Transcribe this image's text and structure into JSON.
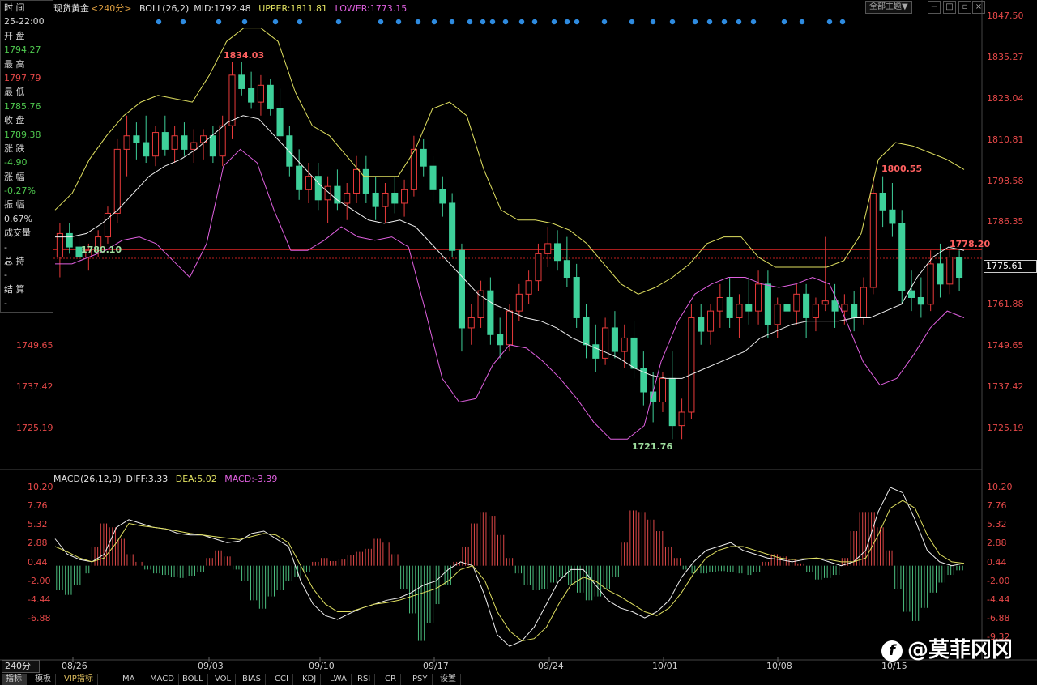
{
  "header": {
    "symbol": "现货黄金",
    "period": "<240分>",
    "boll_label": "BOLL(26,2)",
    "mid": "MID:1792.48",
    "upper": "UPPER:1811.81",
    "lower": "LOWER:1773.15",
    "theme_button": "全部主题▼",
    "colors": {
      "mid": "#f0f0f0",
      "upper": "#e0e060",
      "lower": "#e060e0"
    }
  },
  "info_panel": [
    {
      "label": "时 间",
      "value": "25-22:00",
      "tone": "white"
    },
    {
      "label": "开 盘",
      "value": "1794.27",
      "tone": "green"
    },
    {
      "label": "最 高",
      "value": "1797.79",
      "tone": "red"
    },
    {
      "label": "最 低",
      "value": "1785.76",
      "tone": "green"
    },
    {
      "label": "收 盘",
      "value": "1789.38",
      "tone": "green"
    },
    {
      "label": "涨 跌",
      "value": "-4.90",
      "tone": "green"
    },
    {
      "label": "涨 幅",
      "value": "-0.27%",
      "tone": "green"
    },
    {
      "label": "振 幅",
      "value": "0.67%",
      "tone": "white"
    },
    {
      "label": "成交量",
      "value": "-",
      "tone": "white"
    },
    {
      "label": "总 持",
      "value": "-",
      "tone": "white"
    },
    {
      "label": "结 算",
      "value": "-",
      "tone": "white"
    }
  ],
  "price_axis_right": [
    "1847.50",
    "1835.27",
    "1823.04",
    "1810.81",
    "1798.58",
    "1786.35",
    "1761.88",
    "1749.65",
    "1737.42",
    "1725.19"
  ],
  "price_axis_left": [
    "1749.65",
    "1737.42",
    "1725.19"
  ],
  "current_price_tag": "1775.61",
  "date_labels": [
    "08/26",
    "09/03",
    "09/10",
    "09/17",
    "09/24",
    "10/01",
    "10/08",
    "10/15"
  ],
  "annotations": [
    {
      "text": "1834.03",
      "color": "#ff6060"
    },
    {
      "text": "1780.10",
      "color": "#a0e0a0"
    },
    {
      "text": "1721.76",
      "color": "#a0e0a0"
    },
    {
      "text": "1800.55",
      "color": "#ff6060"
    },
    {
      "text": "1778.20",
      "color": "#ff6060"
    }
  ],
  "macd_header": {
    "label": "MACD(26,12,9)",
    "diff": "DIFF:3.33",
    "dea": "DEA:5.02",
    "macd": "MACD:-3.39"
  },
  "macd_axis": [
    "10.20",
    "7.76",
    "5.32",
    "2.88",
    "0.44",
    "-2.00",
    "-4.44",
    "-6.88",
    "-9.32"
  ],
  "period_button": "240分",
  "tabs": [
    "指标",
    "模板",
    "VIP指标",
    "MA",
    "MACD",
    "BOLL",
    "VOL",
    "BIAS",
    "CCI",
    "KDJ",
    "LWA",
    "RSI",
    "CR",
    "PSY",
    "设置"
  ],
  "watermark": "@莫菲冈冈",
  "chart_data": {
    "type": "candlestick",
    "title": "",
    "ylim": [
      1715,
      1850
    ],
    "reference_price": 1778.2,
    "ohlc": [
      [
        1776,
        1786,
        1770,
        1783
      ],
      [
        1783,
        1786,
        1777,
        1779
      ],
      [
        1779,
        1782,
        1774,
        1776
      ],
      [
        1776,
        1780,
        1772,
        1778
      ],
      [
        1778,
        1784,
        1776,
        1782
      ],
      [
        1782,
        1791,
        1780,
        1789
      ],
      [
        1789,
        1811,
        1786,
        1808
      ],
      [
        1808,
        1818,
        1800,
        1812
      ],
      [
        1812,
        1816,
        1805,
        1810
      ],
      [
        1810,
        1818,
        1804,
        1806
      ],
      [
        1806,
        1815,
        1803,
        1813
      ],
      [
        1813,
        1818,
        1806,
        1808
      ],
      [
        1808,
        1815,
        1804,
        1812
      ],
      [
        1812,
        1816,
        1806,
        1808
      ],
      [
        1808,
        1814,
        1804,
        1810
      ],
      [
        1810,
        1814,
        1805,
        1812
      ],
      [
        1812,
        1815,
        1804,
        1806
      ],
      [
        1806,
        1818,
        1803,
        1815
      ],
      [
        1815,
        1834,
        1811,
        1830
      ],
      [
        1830,
        1834,
        1824,
        1826
      ],
      [
        1826,
        1831,
        1820,
        1822
      ],
      [
        1822,
        1830,
        1818,
        1827
      ],
      [
        1827,
        1829,
        1818,
        1820
      ],
      [
        1820,
        1826,
        1810,
        1812
      ],
      [
        1812,
        1815,
        1800,
        1803
      ],
      [
        1803,
        1808,
        1793,
        1796
      ],
      [
        1796,
        1804,
        1792,
        1800
      ],
      [
        1800,
        1804,
        1790,
        1793
      ],
      [
        1793,
        1800,
        1786,
        1797
      ],
      [
        1797,
        1802,
        1790,
        1792
      ],
      [
        1792,
        1798,
        1787,
        1795
      ],
      [
        1795,
        1806,
        1792,
        1802
      ],
      [
        1802,
        1806,
        1792,
        1795
      ],
      [
        1795,
        1800,
        1787,
        1791
      ],
      [
        1791,
        1798,
        1786,
        1795
      ],
      [
        1795,
        1800,
        1789,
        1792
      ],
      [
        1792,
        1799,
        1788,
        1796
      ],
      [
        1796,
        1812,
        1794,
        1808
      ],
      [
        1808,
        1811,
        1800,
        1803
      ],
      [
        1803,
        1806,
        1792,
        1796
      ],
      [
        1796,
        1800,
        1788,
        1792
      ],
      [
        1792,
        1795,
        1776,
        1778
      ],
      [
        1778,
        1780,
        1748,
        1755
      ],
      [
        1755,
        1762,
        1750,
        1758
      ],
      [
        1758,
        1769,
        1755,
        1766
      ],
      [
        1766,
        1770,
        1750,
        1753
      ],
      [
        1753,
        1758,
        1746,
        1750
      ],
      [
        1750,
        1762,
        1748,
        1760
      ],
      [
        1760,
        1768,
        1757,
        1765
      ],
      [
        1765,
        1772,
        1762,
        1769
      ],
      [
        1769,
        1780,
        1766,
        1777
      ],
      [
        1777,
        1785,
        1773,
        1780
      ],
      [
        1780,
        1784,
        1772,
        1775
      ],
      [
        1775,
        1782,
        1767,
        1770
      ],
      [
        1770,
        1774,
        1755,
        1758
      ],
      [
        1758,
        1762,
        1746,
        1750
      ],
      [
        1750,
        1756,
        1742,
        1746
      ],
      [
        1746,
        1758,
        1744,
        1755
      ],
      [
        1755,
        1760,
        1746,
        1748
      ],
      [
        1748,
        1756,
        1743,
        1752
      ],
      [
        1752,
        1757,
        1740,
        1743
      ],
      [
        1743,
        1748,
        1732,
        1736
      ],
      [
        1736,
        1742,
        1727,
        1733
      ],
      [
        1733,
        1742,
        1730,
        1740
      ],
      [
        1740,
        1748,
        1722,
        1726
      ],
      [
        1726,
        1734,
        1722,
        1730
      ],
      [
        1730,
        1762,
        1728,
        1758
      ],
      [
        1758,
        1762,
        1750,
        1754
      ],
      [
        1754,
        1762,
        1750,
        1760
      ],
      [
        1760,
        1768,
        1755,
        1764
      ],
      [
        1764,
        1770,
        1755,
        1758
      ],
      [
        1758,
        1765,
        1752,
        1762
      ],
      [
        1762,
        1770,
        1756,
        1760
      ],
      [
        1760,
        1772,
        1756,
        1768
      ],
      [
        1768,
        1772,
        1752,
        1756
      ],
      [
        1756,
        1764,
        1752,
        1762
      ],
      [
        1762,
        1768,
        1755,
        1760
      ],
      [
        1760,
        1768,
        1756,
        1765
      ],
      [
        1765,
        1768,
        1752,
        1758
      ],
      [
        1758,
        1764,
        1754,
        1762
      ],
      [
        1762,
        1782,
        1760,
        1763
      ],
      [
        1763,
        1768,
        1755,
        1760
      ],
      [
        1760,
        1765,
        1756,
        1762
      ],
      [
        1762,
        1766,
        1754,
        1758
      ],
      [
        1758,
        1770,
        1756,
        1767
      ],
      [
        1767,
        1800,
        1765,
        1795
      ],
      [
        1795,
        1800,
        1785,
        1790
      ],
      [
        1790,
        1798,
        1782,
        1786
      ],
      [
        1786,
        1790,
        1762,
        1766
      ],
      [
        1766,
        1772,
        1760,
        1764
      ],
      [
        1764,
        1770,
        1758,
        1762
      ],
      [
        1762,
        1778,
        1760,
        1774
      ],
      [
        1774,
        1780,
        1764,
        1768
      ],
      [
        1768,
        1778,
        1765,
        1776
      ],
      [
        1776,
        1778,
        1766,
        1770
      ]
    ],
    "boll_mid": [
      1782,
      1782,
      1783,
      1786,
      1790,
      1795,
      1800,
      1803,
      1805,
      1808,
      1812,
      1816,
      1818,
      1817,
      1812,
      1807,
      1802,
      1797,
      1793,
      1790,
      1787,
      1786,
      1787,
      1785,
      1780,
      1775,
      1770,
      1765,
      1762,
      1760,
      1758,
      1757,
      1755,
      1752,
      1750,
      1748,
      1746,
      1743,
      1741,
      1740,
      1740,
      1742,
      1744,
      1746,
      1748,
      1752,
      1754,
      1756,
      1757,
      1757,
      1757,
      1758,
      1758,
      1760,
      1762,
      1770,
      1776,
      1779,
      1778
    ],
    "boll_upper": [
      1790,
      1795,
      1805,
      1812,
      1818,
      1822,
      1824,
      1823,
      1822,
      1830,
      1840,
      1844,
      1844,
      1840,
      1825,
      1815,
      1812,
      1806,
      1800,
      1800,
      1800,
      1808,
      1820,
      1822,
      1818,
      1802,
      1790,
      1787,
      1787,
      1786,
      1784,
      1780,
      1774,
      1768,
      1765,
      1767,
      1770,
      1774,
      1780,
      1782,
      1782,
      1776,
      1773,
      1773,
      1773,
      1773,
      1775,
      1783,
      1805,
      1810,
      1809,
      1807,
      1805,
      1802
    ],
    "boll_lower": [
      1774,
      1774,
      1776,
      1778,
      1781,
      1782,
      1780,
      1775,
      1770,
      1780,
      1803,
      1808,
      1804,
      1790,
      1778,
      1778,
      1781,
      1785,
      1782,
      1781,
      1782,
      1779,
      1760,
      1740,
      1733,
      1734,
      1744,
      1750,
      1749,
      1745,
      1740,
      1734,
      1727,
      1722,
      1722,
      1726,
      1745,
      1757,
      1765,
      1768,
      1770,
      1770,
      1768,
      1767,
      1768,
      1770,
      1768,
      1757,
      1745,
      1738,
      1740,
      1747,
      1755,
      1760,
      1758
    ],
    "macd_hist": [
      -3.2,
      -3.8,
      -2.5,
      -1,
      2.5,
      5.5,
      5,
      3.5,
      1.5,
      0.5,
      -0.5,
      -1,
      -1.2,
      -1.5,
      -1.6,
      -1.3,
      -0.8,
      1,
      2,
      1.2,
      -0.5,
      -2,
      -4.5,
      -5.6,
      -4,
      -3.2,
      -2,
      -1.5,
      -0.8,
      0.5,
      1,
      0.6,
      0.8,
      1.4,
      1.8,
      2.2,
      3.5,
      3,
      1.5,
      -3,
      -6.2,
      -9.8,
      -7.5,
      -5,
      -2.5,
      0.5,
      2.5,
      5.5,
      7,
      6.5,
      4,
      1,
      -1,
      -2.5,
      -3.2,
      -3,
      -2.2,
      -1.5,
      -2.5,
      -3.5,
      -4.5,
      -4,
      -3,
      -1.5,
      3,
      7.2,
      7,
      6,
      4.5,
      2.5,
      1,
      -0.5,
      -1,
      -1,
      -0.8,
      -0.7,
      -0.8,
      -1,
      -1.2,
      -0.8,
      0.5,
      1.5,
      1.2,
      0.8,
      0.3,
      -0.8,
      -1.8,
      -1.6,
      -1.2,
      1,
      4.5,
      7,
      7,
      5,
      2,
      -3,
      -6,
      -7.2,
      -5.5,
      -3.5,
      -2.2,
      -1.2,
      -0.6
    ],
    "diff": [
      3.5,
      1.5,
      0.8,
      0.5,
      1.5,
      5,
      6,
      5.5,
      5,
      4.8,
      4.2,
      4,
      4,
      3.5,
      3,
      3.2,
      4.2,
      4.5,
      3.5,
      2.5,
      -2,
      -5,
      -6.5,
      -7,
      -6.2,
      -5.5,
      -5,
      -4.5,
      -4.2,
      -3.5,
      -2.5,
      -2,
      -0.5,
      0.5,
      0,
      -4,
      -9,
      -10.5,
      -9.8,
      -8,
      -5,
      -2,
      -0.5,
      -0.5,
      -2.5,
      -4.5,
      -5.5,
      -6,
      -6.8,
      -6,
      -4.5,
      -1.5,
      0.5,
      2,
      2.5,
      3,
      2,
      1.5,
      1,
      0.8,
      0.5,
      0.8,
      1,
      0.5,
      0,
      0.5,
      2,
      7,
      10.2,
      9.5,
      6,
      2,
      0.5,
      0,
      0.3
    ],
    "dea": [
      2.5,
      1.8,
      1,
      0.5,
      1,
      3,
      5.5,
      5.2,
      5,
      4.8,
      4.5,
      4.2,
      4,
      3.8,
      3.6,
      3.4,
      3.8,
      4.2,
      4,
      3,
      0,
      -3,
      -5,
      -6,
      -6,
      -5.5,
      -5,
      -4.8,
      -4.5,
      -4,
      -3.5,
      -3,
      -2,
      -0.5,
      0,
      -2,
      -6,
      -8.5,
      -9.8,
      -9.5,
      -8,
      -5,
      -2.5,
      -1.5,
      -2,
      -3.2,
      -4,
      -5,
      -6,
      -6.5,
      -5.5,
      -3.5,
      -1,
      1,
      2,
      2.5,
      2.5,
      2,
      1.5,
      1,
      0.8,
      0.9,
      1,
      0.8,
      0.5,
      0.5,
      1,
      4,
      7.5,
      8.5,
      7.5,
      4,
      1.5,
      0.5,
      0.3
    ]
  }
}
